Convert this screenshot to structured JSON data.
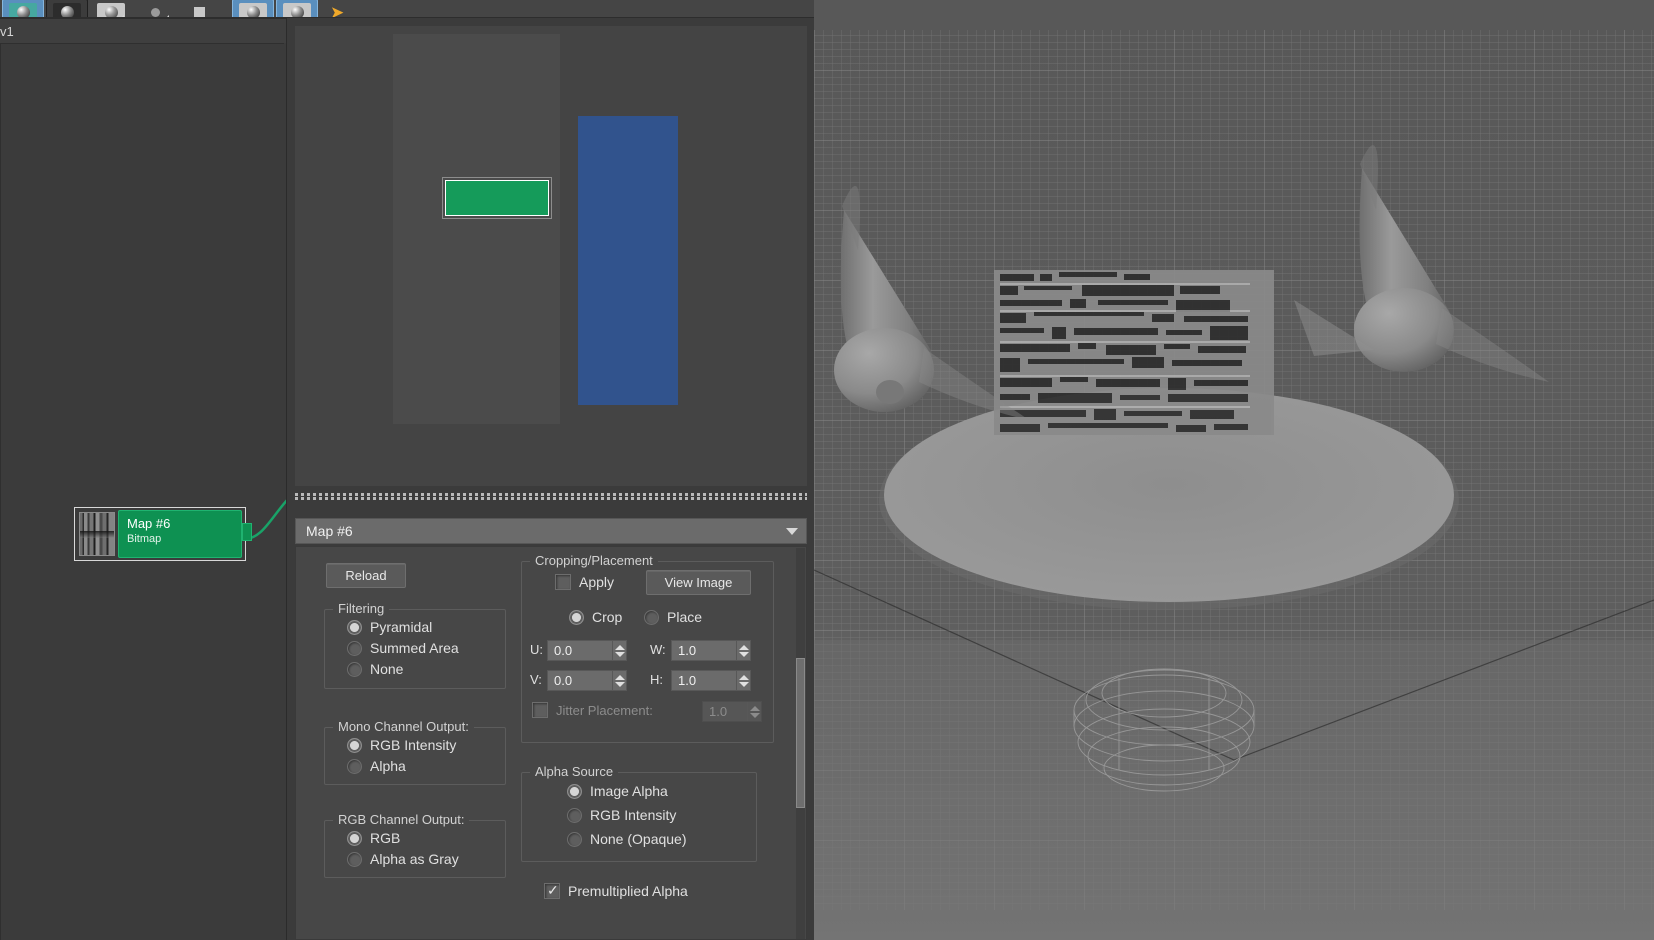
{
  "toolbar": {
    "buttons": [
      {
        "name": "material-sample-sphere",
        "icon": "sphere-teal-icon",
        "selected": true
      },
      {
        "name": "material-dark-sphere",
        "icon": "sphere-dark-icon",
        "selected": false
      },
      {
        "name": "assign-material-to-selection",
        "icon": "sphere-light-icon",
        "selected": false
      },
      {
        "name": "show-shaded-material-in-viewport",
        "icon": "small-sphere-icon",
        "selected": false
      },
      {
        "name": "show-end-result",
        "icon": "square-icon",
        "selected": false
      },
      {
        "name": "make-preview",
        "icon": "sphere-square-icon",
        "selected": true
      },
      {
        "name": "material-id-channel",
        "icon": "sphere-dark-icon",
        "selected": true
      },
      {
        "name": "select-tool",
        "icon": "cursor-arrow-icon",
        "selected": false
      }
    ]
  },
  "nodeview": {
    "label": "v1",
    "node": {
      "title": "Map #6",
      "subtitle": "Bitmap",
      "thumbnail": "bitmap-thumbnail"
    }
  },
  "preview": {
    "label": "material-preview"
  },
  "map_selector": {
    "value": "Map #6",
    "caret": "chevron-down-icon"
  },
  "params": {
    "reload_label": "Reload",
    "filtering": {
      "title": "Filtering",
      "options": [
        {
          "label": "Pyramidal",
          "selected": true
        },
        {
          "label": "Summed Area",
          "selected": false
        },
        {
          "label": "None",
          "selected": false
        }
      ]
    },
    "mono_channel_output": {
      "title": "Mono Channel Output:",
      "options": [
        {
          "label": "RGB Intensity",
          "selected": true
        },
        {
          "label": "Alpha",
          "selected": false
        }
      ]
    },
    "rgb_channel_output": {
      "title": "RGB Channel Output:",
      "options": [
        {
          "label": "RGB",
          "selected": true
        },
        {
          "label": "Alpha as Gray",
          "selected": false
        }
      ]
    },
    "cropping": {
      "title": "Cropping/Placement",
      "apply_label": "Apply",
      "apply_checked": false,
      "view_image_label": "View Image",
      "mode": [
        {
          "label": "Crop",
          "selected": true
        },
        {
          "label": "Place",
          "selected": false
        }
      ],
      "fields": [
        {
          "label": "U:",
          "value": "0.0"
        },
        {
          "label": "W:",
          "value": "1.0"
        },
        {
          "label": "V:",
          "value": "0.0"
        },
        {
          "label": "H:",
          "value": "1.0"
        }
      ],
      "jitter": {
        "label": "Jitter Placement:",
        "value": "1.0",
        "checked": false,
        "disabled": true
      }
    },
    "alpha_source": {
      "title": "Alpha Source",
      "options": [
        {
          "label": "Image Alpha",
          "selected": true
        },
        {
          "label": "RGB Intensity",
          "selected": false
        },
        {
          "label": "None (Opaque)",
          "selected": false
        }
      ],
      "premultiplied": {
        "label": "Premultiplied Alpha",
        "checked": true
      }
    }
  },
  "viewport": {
    "label": "perspective-viewport",
    "objects": [
      "cone-left",
      "cone-right",
      "textured-disc",
      "wireframe-torus",
      "ground-grid"
    ]
  },
  "colors": {
    "node_green": "#0e9152",
    "preview_blue": "#31538d",
    "preview_green": "#159b5a",
    "accent_blue": "#5a8fbe",
    "panel_bg": "#474747"
  }
}
